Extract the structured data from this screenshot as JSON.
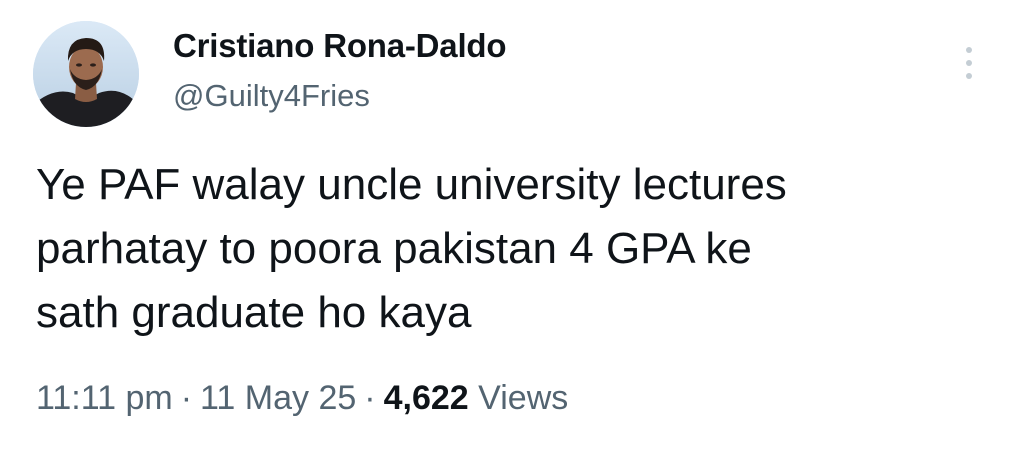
{
  "tweet": {
    "author": {
      "display_name": "Cristiano Rona-Daldo",
      "handle": "@Guilty4Fries",
      "avatar_icon": "profile-photo"
    },
    "more_icon": "vertical-ellipsis-icon",
    "text_lines": [
      "Ye PAF walay uncle university lectures",
      "parhatay to poora pakistan 4 GPA ke",
      "sath graduate ho kaya"
    ],
    "meta": {
      "time": "11:11 pm",
      "separator": "·",
      "date": "11 May 25",
      "views_count": "4,622",
      "views_label": "Views"
    },
    "colors": {
      "text": "#0f1419",
      "secondary": "#536471",
      "background": "#ffffff"
    }
  }
}
